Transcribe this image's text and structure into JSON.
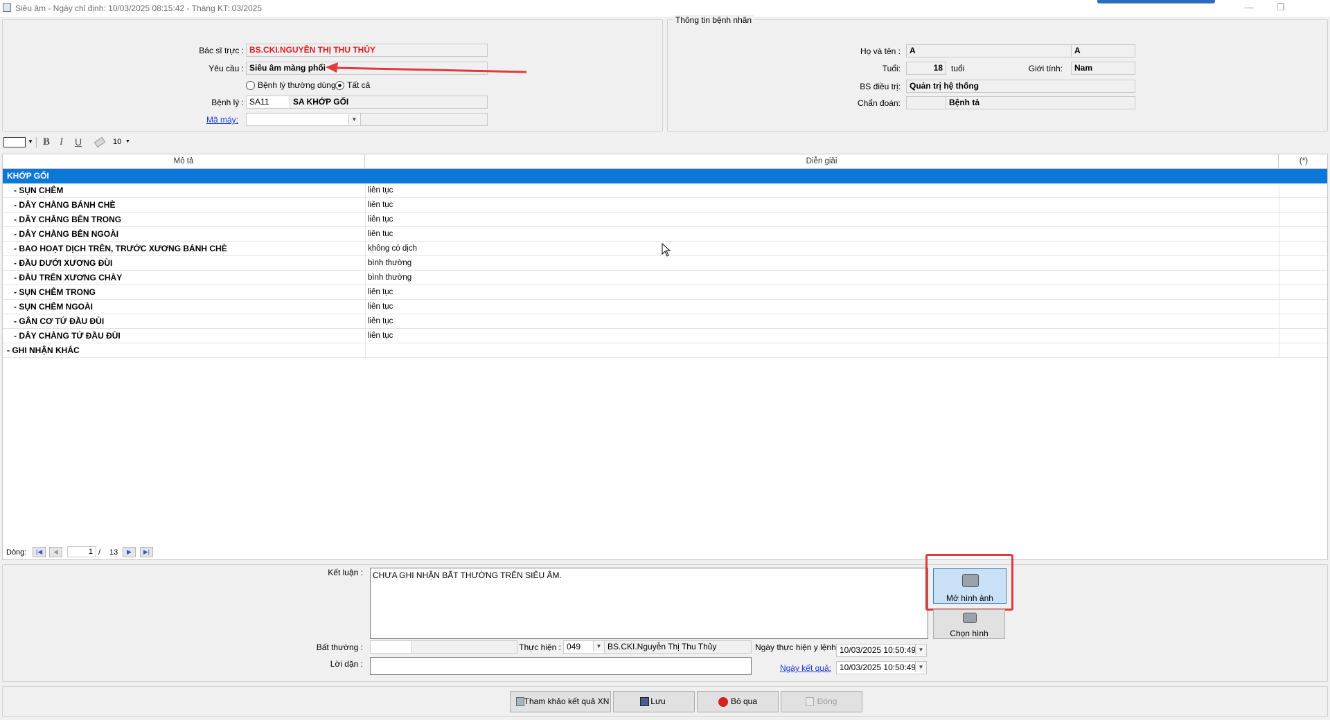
{
  "window": {
    "title": "Siêu âm - Ngày chỉ định: 10/03/2025 08:15:42 - Tháng KT: 03/2025",
    "minimize": "—",
    "restore": "❐"
  },
  "request_panel": {
    "doctor_label": "Bác sĩ trực :",
    "doctor_value": "BS.CKI.NGUYỄN THỊ THU THỦY",
    "request_label": "Yêu cầu :",
    "request_value": "Siêu âm màng phổi",
    "radio_common": "Bệnh lý thường dùng",
    "radio_all": "Tất cả",
    "disease_label": "Bệnh lý :",
    "disease_code": "SA11",
    "disease_name": "SA KHỚP GỐI",
    "machine_label": "Mã máy:"
  },
  "patient_panel": {
    "group_title": "Thông tin bệnh nhân",
    "name_label": "Họ và tên :",
    "name_value": "A",
    "name_value2": "A",
    "age_label": "Tuổi:",
    "age_value": "18",
    "age_unit": "tuổi",
    "gender_label": "Giới tính:",
    "gender_value": "Nam",
    "treating_label": "BS điều trị:",
    "treating_value": "Quản trị hệ thống",
    "diagnosis_label": "Chẩn đoán:",
    "diagnosis_value": "Bệnh tả"
  },
  "toolbar": {
    "bold": "B",
    "italic": "I",
    "underline": "U",
    "font_size": "10"
  },
  "grid": {
    "headers": [
      "Mô tả",
      "Diễn giải",
      "(*)"
    ],
    "rows": [
      {
        "desc": "KHỚP GỐI",
        "value": ""
      },
      {
        "desc": "   - SỤN CHÊM",
        "value": "liên tục"
      },
      {
        "desc": "   - DÂY CHẰNG BÁNH CHÈ",
        "value": "liên tục"
      },
      {
        "desc": "   - DÂY CHẰNG BÊN TRONG",
        "value": "liên tục"
      },
      {
        "desc": "   - DÂY CHẰNG BÊN NGOÀI",
        "value": "liên tục"
      },
      {
        "desc": "   - BAO HOẠT DỊCH TRÊN, TRƯỚC XƯƠNG BÁNH CHÈ",
        "value": "không có dịch"
      },
      {
        "desc": "   - ĐẦU DƯỚI XƯƠNG ĐÙI",
        "value": "bình thường"
      },
      {
        "desc": "   - ĐẦU TRÊN XƯƠNG CHÀY",
        "value": "bình thường"
      },
      {
        "desc": "   - SỤN CHÊM TRONG",
        "value": "liên tục"
      },
      {
        "desc": "   - SỤN CHÊM NGOÀI",
        "value": "liên tục"
      },
      {
        "desc": "   - GÂN CƠ TỨ ĐẦU ĐÙI",
        "value": "liên tục"
      },
      {
        "desc": "   - DÂY CHẰNG TỨ ĐẦU ĐÙI",
        "value": "liên tục"
      },
      {
        "desc": "- GHI NHẬN KHÁC",
        "value": ""
      }
    ]
  },
  "pager": {
    "label": "Dòng:",
    "current": "1",
    "separator": "/",
    "total": "13"
  },
  "result": {
    "conclusion_label": "Kết luận :",
    "conclusion_value": "CHƯA GHI NHẬN BẤT THƯỜNG TRÊN SIÊU ÂM.",
    "open_image_label": "Mở hình ảnh",
    "choose_image_label": "Chọn hình",
    "abnormal_label": "Bất thường :",
    "performer_label": "Thực hiện :",
    "performer_code": "049",
    "performer_name": "BS.CKI.Nguyễn Thị Thu Thủy",
    "exec_date_label": "Ngày thực hiện y lệnh:",
    "exec_date_value": "10/03/2025 10:50:49",
    "advice_label": "Lời dặn :",
    "result_date_label": "Ngày kết quả:",
    "result_date_value": "10/03/2025 10:50:49"
  },
  "footer": {
    "ref_button": "Tham khảo kết quả XN",
    "save_button": "Lưu",
    "skip_button": "Bỏ qua",
    "close_button": "Đóng"
  },
  "colors": {
    "selection": "#0b78d7",
    "annotation_red": "#e03a3a",
    "doctor_red": "#e11b1b"
  }
}
